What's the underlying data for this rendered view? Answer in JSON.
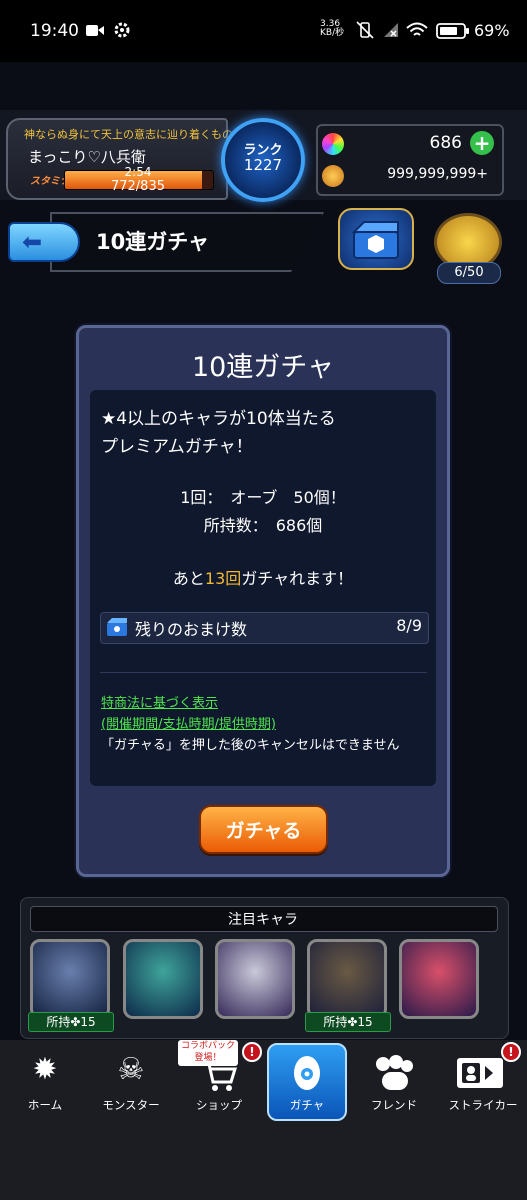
{
  "status_bar": {
    "time": "19:40",
    "network_speed_value": "3.36",
    "network_speed_unit": "KB/秒",
    "battery": "69%"
  },
  "player": {
    "title": "神ならぬ身にて天上の意志に辿り着くもの",
    "name": "まっこり♡八兵衛",
    "stamina_label": "スタミナ",
    "stamina_timer": "2:54",
    "stamina_value": "772/835",
    "stamina_fraction": 0.924,
    "rank_label": "ランク",
    "rank_value": "1227"
  },
  "currency": {
    "orbs": "686",
    "coins": "999,999,999+"
  },
  "nav": {
    "page_title": "10連ガチャ",
    "medal_count": "6/50"
  },
  "dialog": {
    "title": "10連ガチャ",
    "desc_line1": "★4以上のキャラが10体当たる",
    "desc_line2": "プレミアムガチャ！",
    "cost_line": "1回：　オーブ　50個！",
    "owned_line": "所持数：　686個",
    "remaining_prefix": "あと",
    "remaining_count": "13回",
    "remaining_suffix": "ガチャれます！",
    "bonus_label": "残りのおまけ数",
    "bonus_value": "8/9",
    "legal_link1": "特商法に基づく表示",
    "legal_link2": "(開催期間/支払時期/提供時期)",
    "legal_note": "「ガチャる」を押した後のキャンセルはできません",
    "gacha_button": "ガチャる"
  },
  "featured": {
    "title": "注目キャラ",
    "characters": [
      {
        "owned": "所持✤15"
      },
      {
        "owned": ""
      },
      {
        "owned": ""
      },
      {
        "owned": "所持✤15"
      },
      {
        "owned": ""
      }
    ]
  },
  "bottom_nav": {
    "items": [
      {
        "label": "ホーム",
        "icon": "home-icon"
      },
      {
        "label": "モンスター",
        "icon": "monster-icon"
      },
      {
        "label": "ショップ",
        "icon": "shop-cart-icon",
        "badge": "コラボパック\n登場！"
      },
      {
        "label": "ガチャ",
        "icon": "gacha-egg-icon"
      },
      {
        "label": "フレンド",
        "icon": "friend-icon"
      },
      {
        "label": "ストライカー",
        "icon": "striker-card-icon"
      }
    ],
    "alert_mark": "!"
  },
  "colors": {
    "accent_gold": "#f2b933",
    "link_green": "#4ee34e",
    "gacha_button": "#ea5c05",
    "active_tab": "#2f9ef2"
  }
}
